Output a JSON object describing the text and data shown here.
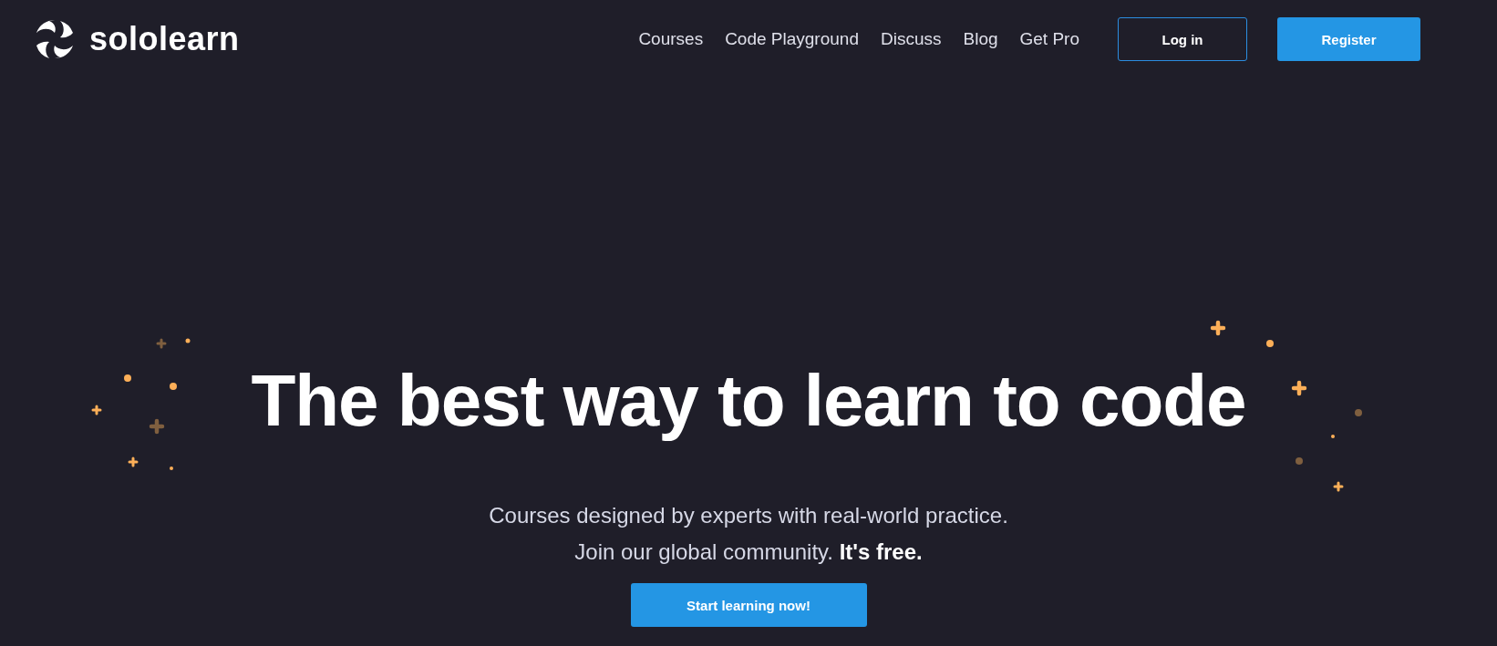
{
  "header": {
    "logo_text": "sololearn",
    "nav": [
      "Courses",
      "Code Playground",
      "Discuss",
      "Blog",
      "Get Pro"
    ],
    "buttons": [
      {
        "label": "Log in",
        "kind": "outline"
      },
      {
        "label": "Register",
        "kind": "filled"
      }
    ]
  },
  "hero": {
    "headline": "The best way to learn to code",
    "subtitle_lines": [
      "Courses designed by experts with real-world practice.",
      "Join our global community. **It's free.**"
    ],
    "cta": "Start learning now!"
  }
}
